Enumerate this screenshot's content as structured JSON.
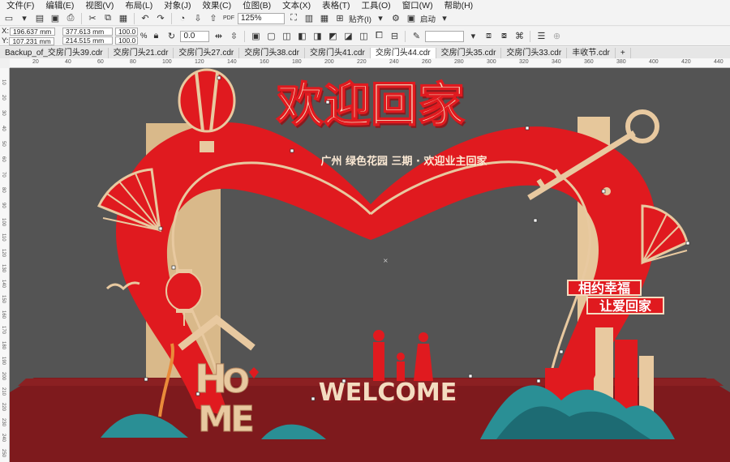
{
  "menu": [
    "文件(F)",
    "编辑(E)",
    "视图(V)",
    "布局(L)",
    "对象(J)",
    "效果(C)",
    "位图(B)",
    "文本(X)",
    "表格(T)",
    "工具(O)",
    "窗口(W)",
    "帮助(H)"
  ],
  "toolbar": {
    "zoom": "125%",
    "snap_label": "贴齐(I)",
    "launch_label": "启动"
  },
  "props": {
    "x": "196.637 mm",
    "y": "107.231 mm",
    "w": "377.613 mm",
    "h": "214.515 mm",
    "scale_w": "100.0",
    "scale_h": "100.0",
    "pct": "%",
    "angle": "0.0",
    "x_label": "X:",
    "y_label": "Y:"
  },
  "tabs": [
    {
      "label": "Backup_of_交房门头39.cdr",
      "active": false
    },
    {
      "label": "交房门头21.cdr",
      "active": false
    },
    {
      "label": "交房门头27.cdr",
      "active": false
    },
    {
      "label": "交房门头38.cdr",
      "active": false
    },
    {
      "label": "交房门头41.cdr",
      "active": false
    },
    {
      "label": "交房门头44.cdr",
      "active": true
    },
    {
      "label": "交房门头35.cdr",
      "active": false
    },
    {
      "label": "交房门头33.cdr",
      "active": false
    },
    {
      "label": "丰收节.cdr",
      "active": false
    }
  ],
  "ruler_ticks": [
    "20",
    "40",
    "60",
    "80",
    "100",
    "120",
    "140",
    "160",
    "180",
    "200",
    "220",
    "240",
    "260",
    "280",
    "300",
    "320",
    "340",
    "360",
    "380",
    "400",
    "420",
    "440"
  ],
  "ruler_vticks": [
    "10",
    "20",
    "30",
    "40",
    "50",
    "60",
    "70",
    "80",
    "90",
    "100",
    "110",
    "120",
    "130",
    "140",
    "150",
    "160",
    "170",
    "180",
    "190",
    "200",
    "210",
    "220",
    "230",
    "240",
    "250"
  ],
  "artwork": {
    "title": "欢迎回家",
    "subtitle": "广州 绿色花园 三期 · 欢迎业主回家",
    "slogan1": "相约幸福",
    "slogan2": "让爱回家",
    "welcome": "WELCOME",
    "home_h": "H",
    "home_o": "O",
    "home_m": "M",
    "home_e": "E",
    "colors": {
      "red": "#e01a1f",
      "gold": "#e8c9a0",
      "dark": "#8a1a1e",
      "teal": "#2a8f95"
    }
  }
}
